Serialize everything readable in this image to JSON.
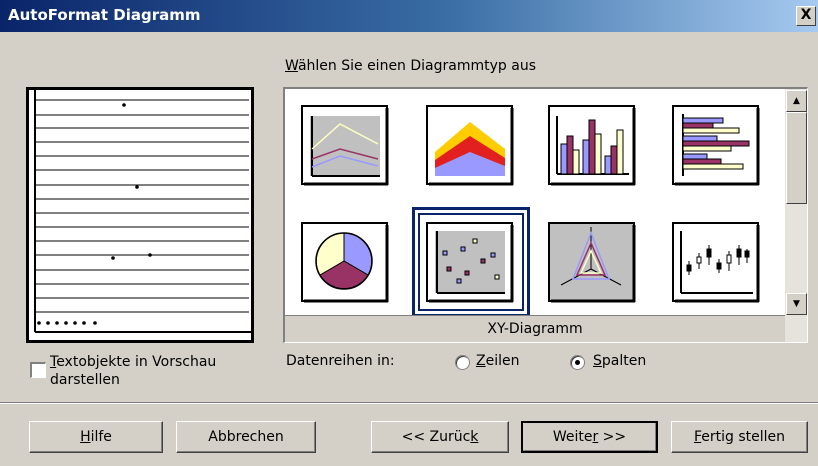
{
  "window": {
    "title": "AutoFormat Diagramm",
    "close_label": "X"
  },
  "chart_type_section": {
    "label_accesskey": "W",
    "label_rest": "ählen Sie einen Diagrammtyp aus",
    "selected_type_name": "XY-Diagramm",
    "types": [
      {
        "icon": "line-chart-icon"
      },
      {
        "icon": "area-chart-icon"
      },
      {
        "icon": "column-chart-icon"
      },
      {
        "icon": "bar-chart-icon"
      },
      {
        "icon": "pie-chart-icon"
      },
      {
        "icon": "xy-scatter-chart-icon",
        "selected": true
      },
      {
        "icon": "radar-chart-icon"
      },
      {
        "icon": "stock-chart-icon"
      }
    ]
  },
  "preview_option": {
    "checked": false,
    "label_accesskey": "T",
    "label_rest": "extobjekte in Vorschau",
    "label_line2": "darstellen"
  },
  "data_series": {
    "label": "Datenreihen in:",
    "option_rows": {
      "accesskey": "Z",
      "rest": "eilen",
      "selected": false
    },
    "option_columns": {
      "accesskey": "S",
      "rest": "palten",
      "selected": true
    }
  },
  "buttons": {
    "help": {
      "accesskey": "H",
      "rest": "ilfe"
    },
    "cancel": {
      "label": "Abbrechen"
    },
    "back": {
      "pre": "<< Zurüc",
      "accesskey": "k",
      "post": ""
    },
    "next": {
      "pre": "Weite",
      "accesskey": "r",
      "post": " >>"
    },
    "finish": {
      "accesskey": "F",
      "rest": "ertig stellen"
    }
  },
  "colors": {
    "titlebar_start": "#0a246a",
    "titlebar_end": "#a6caf0",
    "dialog_face": "#d4d0c8",
    "selection_frame": "#0a246a"
  }
}
